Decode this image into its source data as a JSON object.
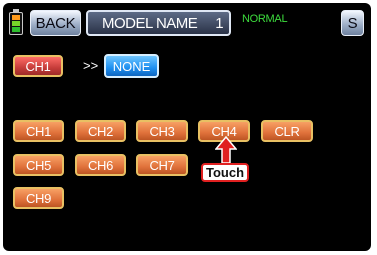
{
  "header": {
    "back_label": "BACK",
    "model_label": "MODEL  NAME",
    "model_number": "1",
    "mode": "NORMAL",
    "s_label": "S",
    "battery_icon": "battery-icon"
  },
  "source": {
    "channel": "CH1",
    "arrow": ">>",
    "target": "NONE"
  },
  "channels": [
    {
      "label": "CH1"
    },
    {
      "label": "CH2"
    },
    {
      "label": "CH3"
    },
    {
      "label": "CH4"
    },
    {
      "label": "CLR"
    },
    {
      "label": "CH5"
    },
    {
      "label": "CH6"
    },
    {
      "label": "CH7"
    },
    {
      "label": "CH9"
    }
  ],
  "callout": {
    "label": "Touch",
    "icon": "up-arrow-icon"
  },
  "colors": {
    "background": "#000000",
    "channel_red": "#c63d3a",
    "channel_orange": "#e0723b",
    "none_blue": "#1e90f0",
    "mode_green": "#3ddc3d",
    "callout_red": "#e02020"
  }
}
